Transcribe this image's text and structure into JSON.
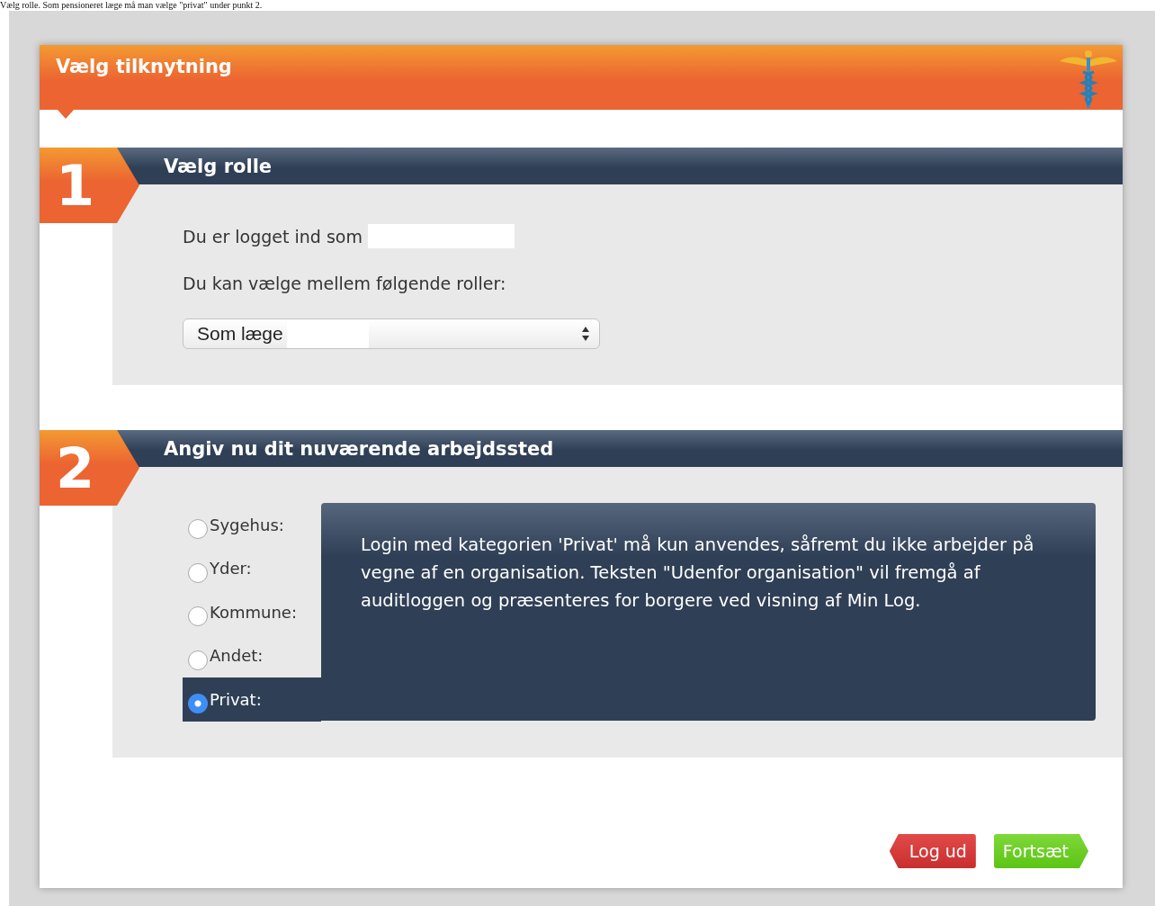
{
  "caption": "Vælg rolle. Som pensioneret læge må man vælge \"privat\" under punkt 2.",
  "dialog": {
    "title": "Vælg tilknytning"
  },
  "sections": [
    {
      "number": "1",
      "title": "Vælg rolle",
      "logged_in_label": "Du er logget ind som",
      "roles_label": "Du kan vælge mellem følgende roller:",
      "role_select": {
        "value": "Som læge"
      }
    },
    {
      "number": "2",
      "title": "Angiv nu dit nuværende arbejdssted",
      "options": [
        {
          "label": "Sygehus:",
          "selected": false
        },
        {
          "label": "Yder:",
          "selected": false
        },
        {
          "label": "Kommune:",
          "selected": false
        },
        {
          "label": "Andet:",
          "selected": false
        },
        {
          "label": "Privat:",
          "selected": true
        }
      ],
      "info": "Login med kategorien 'Privat' må kun anvendes, såfremt du ikke arbejder på vegne af en organisation. Teksten \"Udenfor organisation\" vil fremgå af auditloggen og præsenteres for borgere ved visning af Min Log."
    }
  ],
  "buttons": [
    {
      "label": "Log ud",
      "kind": "back"
    },
    {
      "label": "Fortsæt",
      "kind": "next"
    }
  ]
}
